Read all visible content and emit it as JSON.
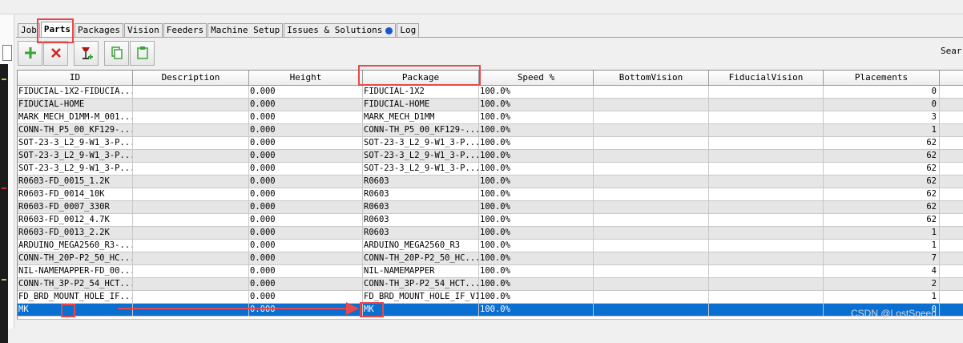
{
  "tabs": [
    {
      "label": "Job",
      "active": false
    },
    {
      "label": "Parts",
      "active": true
    },
    {
      "label": "Packages",
      "active": false
    },
    {
      "label": "Vision",
      "active": false
    },
    {
      "label": "Feeders",
      "active": false
    },
    {
      "label": "Machine Setup",
      "active": false
    },
    {
      "label": "Issues & Solutions",
      "active": false,
      "badge_icon": "blue-dot"
    },
    {
      "label": "Log",
      "active": false
    }
  ],
  "toolbar": {
    "buttons": [
      "add-icon",
      "delete-icon",
      "pick-icon",
      "copy-icon",
      "paste-icon"
    ],
    "search_label": "Sear"
  },
  "colors": {
    "accent_red": "#e8484a",
    "selection_blue": "#0a6fd1",
    "add_green": "#3aa33a",
    "delete_red": "#d02020"
  },
  "table": {
    "columns": [
      "ID",
      "Description",
      "Height",
      "Package",
      "Speed %",
      "BottomVision",
      "FiducialVision",
      "Placements",
      ""
    ],
    "rows": [
      [
        "FIDUCIAL-1X2-FIDUCIA...",
        "",
        "0.000",
        "FIDUCIAL-1X2",
        "100.0%",
        "",
        "",
        "0",
        ""
      ],
      [
        "FIDUCIAL-HOME",
        "",
        "0.000",
        "FIDUCIAL-HOME",
        "100.0%",
        "",
        "",
        "0",
        ""
      ],
      [
        "MARK_MECH_D1MM-M_001...",
        "",
        "0.000",
        "MARK_MECH_D1MM",
        "100.0%",
        "",
        "",
        "3",
        ""
      ],
      [
        "CONN-TH_P5_00_KF129-...",
        "",
        "0.000",
        "CONN-TH_P5_00_KF129-...",
        "100.0%",
        "",
        "",
        "1",
        ""
      ],
      [
        "SOT-23-3_L2_9-W1_3-P...",
        "",
        "0.000",
        "SOT-23-3_L2_9-W1_3-P...",
        "100.0%",
        "",
        "",
        "62",
        ""
      ],
      [
        "SOT-23-3_L2_9-W1_3-P...",
        "",
        "0.000",
        "SOT-23-3_L2_9-W1_3-P...",
        "100.0%",
        "",
        "",
        "62",
        ""
      ],
      [
        "SOT-23-3_L2_9-W1_3-P...",
        "",
        "0.000",
        "SOT-23-3_L2_9-W1_3-P...",
        "100.0%",
        "",
        "",
        "62",
        ""
      ],
      [
        "R0603-FD_0015_1.2K",
        "",
        "0.000",
        "R0603",
        "100.0%",
        "",
        "",
        "62",
        ""
      ],
      [
        "R0603-FD_0014_10K",
        "",
        "0.000",
        "R0603",
        "100.0%",
        "",
        "",
        "62",
        ""
      ],
      [
        "R0603-FD_0007_330R",
        "",
        "0.000",
        "R0603",
        "100.0%",
        "",
        "",
        "62",
        ""
      ],
      [
        "R0603-FD_0012_4.7K",
        "",
        "0.000",
        "R0603",
        "100.0%",
        "",
        "",
        "62",
        ""
      ],
      [
        "R0603-FD_0013_2.2K",
        "",
        "0.000",
        "R0603",
        "100.0%",
        "",
        "",
        "1",
        ""
      ],
      [
        "ARDUINO_MEGA2560_R3-...",
        "",
        "0.000",
        "ARDUINO_MEGA2560_R3",
        "100.0%",
        "",
        "",
        "1",
        ""
      ],
      [
        "CONN-TH_20P-P2_50_HC...",
        "",
        "0.000",
        "CONN-TH_20P-P2_50_HC...",
        "100.0%",
        "",
        "",
        "7",
        ""
      ],
      [
        "NIL-NAMEMAPPER-FD_00...",
        "",
        "0.000",
        "NIL-NAMEMAPPER",
        "100.0%",
        "",
        "",
        "4",
        ""
      ],
      [
        "CONN-TH_3P-P2_54_HCT...",
        "",
        "0.000",
        "CONN-TH_3P-P2_54_HCT...",
        "100.0%",
        "",
        "",
        "2",
        ""
      ],
      [
        "FD_BRD_MOUNT_HOLE_IF...",
        "",
        "0.000",
        "FD_BRD_MOUNT_HOLE_IF_V1",
        "100.0%",
        "",
        "",
        "1",
        ""
      ],
      [
        "MK",
        "",
        "0.000",
        "MK",
        "100.0%",
        "",
        "",
        "0",
        ""
      ]
    ],
    "selected_row": 17
  },
  "watermark": "CSDN @LostSpeed"
}
